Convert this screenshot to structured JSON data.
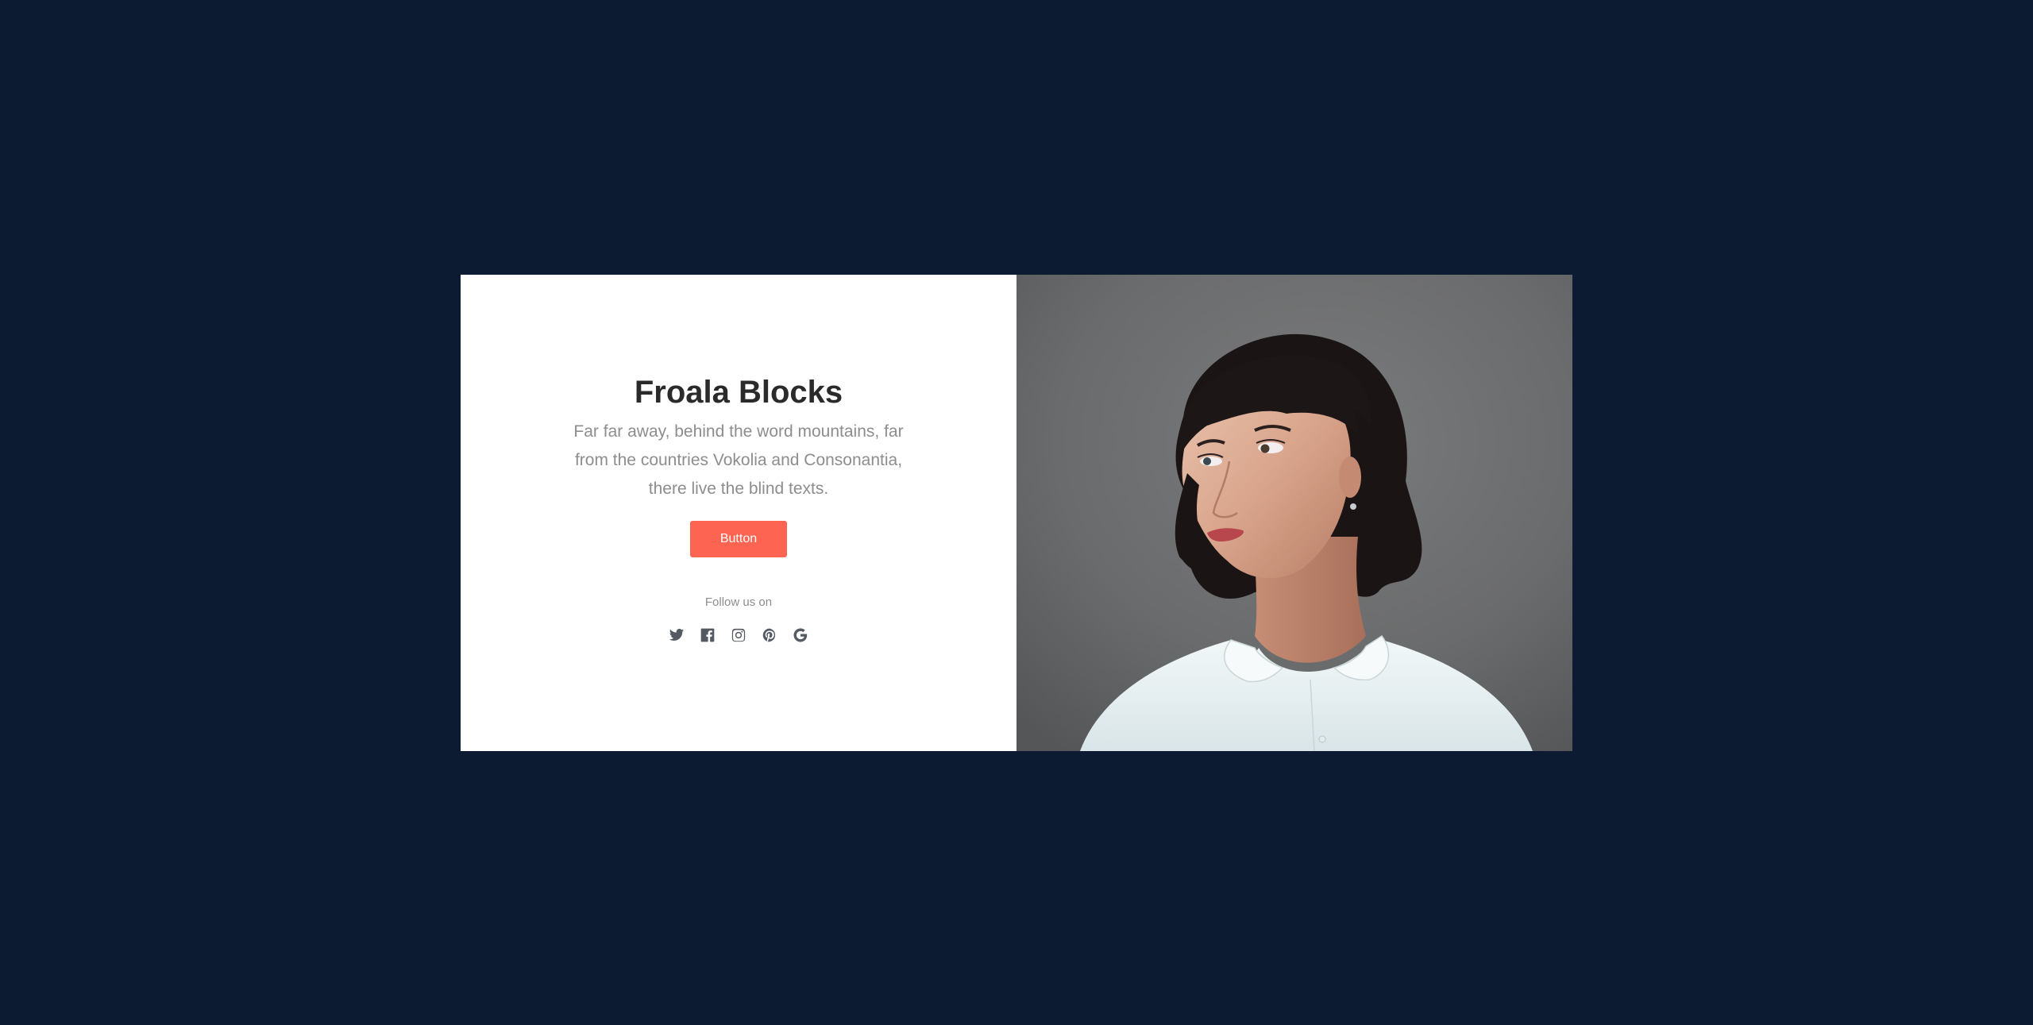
{
  "hero": {
    "title": "Froala Blocks",
    "description": "Far far away, behind the word mountains, far from the countries Vokolia and Consonantia, there live the blind texts.",
    "button_label": "Button",
    "follow_label": "Follow us on",
    "social_icons": [
      "twitter-icon",
      "facebook-icon",
      "instagram-icon",
      "pinterest-icon",
      "google-icon"
    ]
  },
  "colors": {
    "page_background": "#0c1b31",
    "card_background": "#ffffff",
    "accent": "#fe6452",
    "title": "#2a2a2a",
    "muted_text": "#8d8d8d",
    "icon": "#555a62"
  }
}
